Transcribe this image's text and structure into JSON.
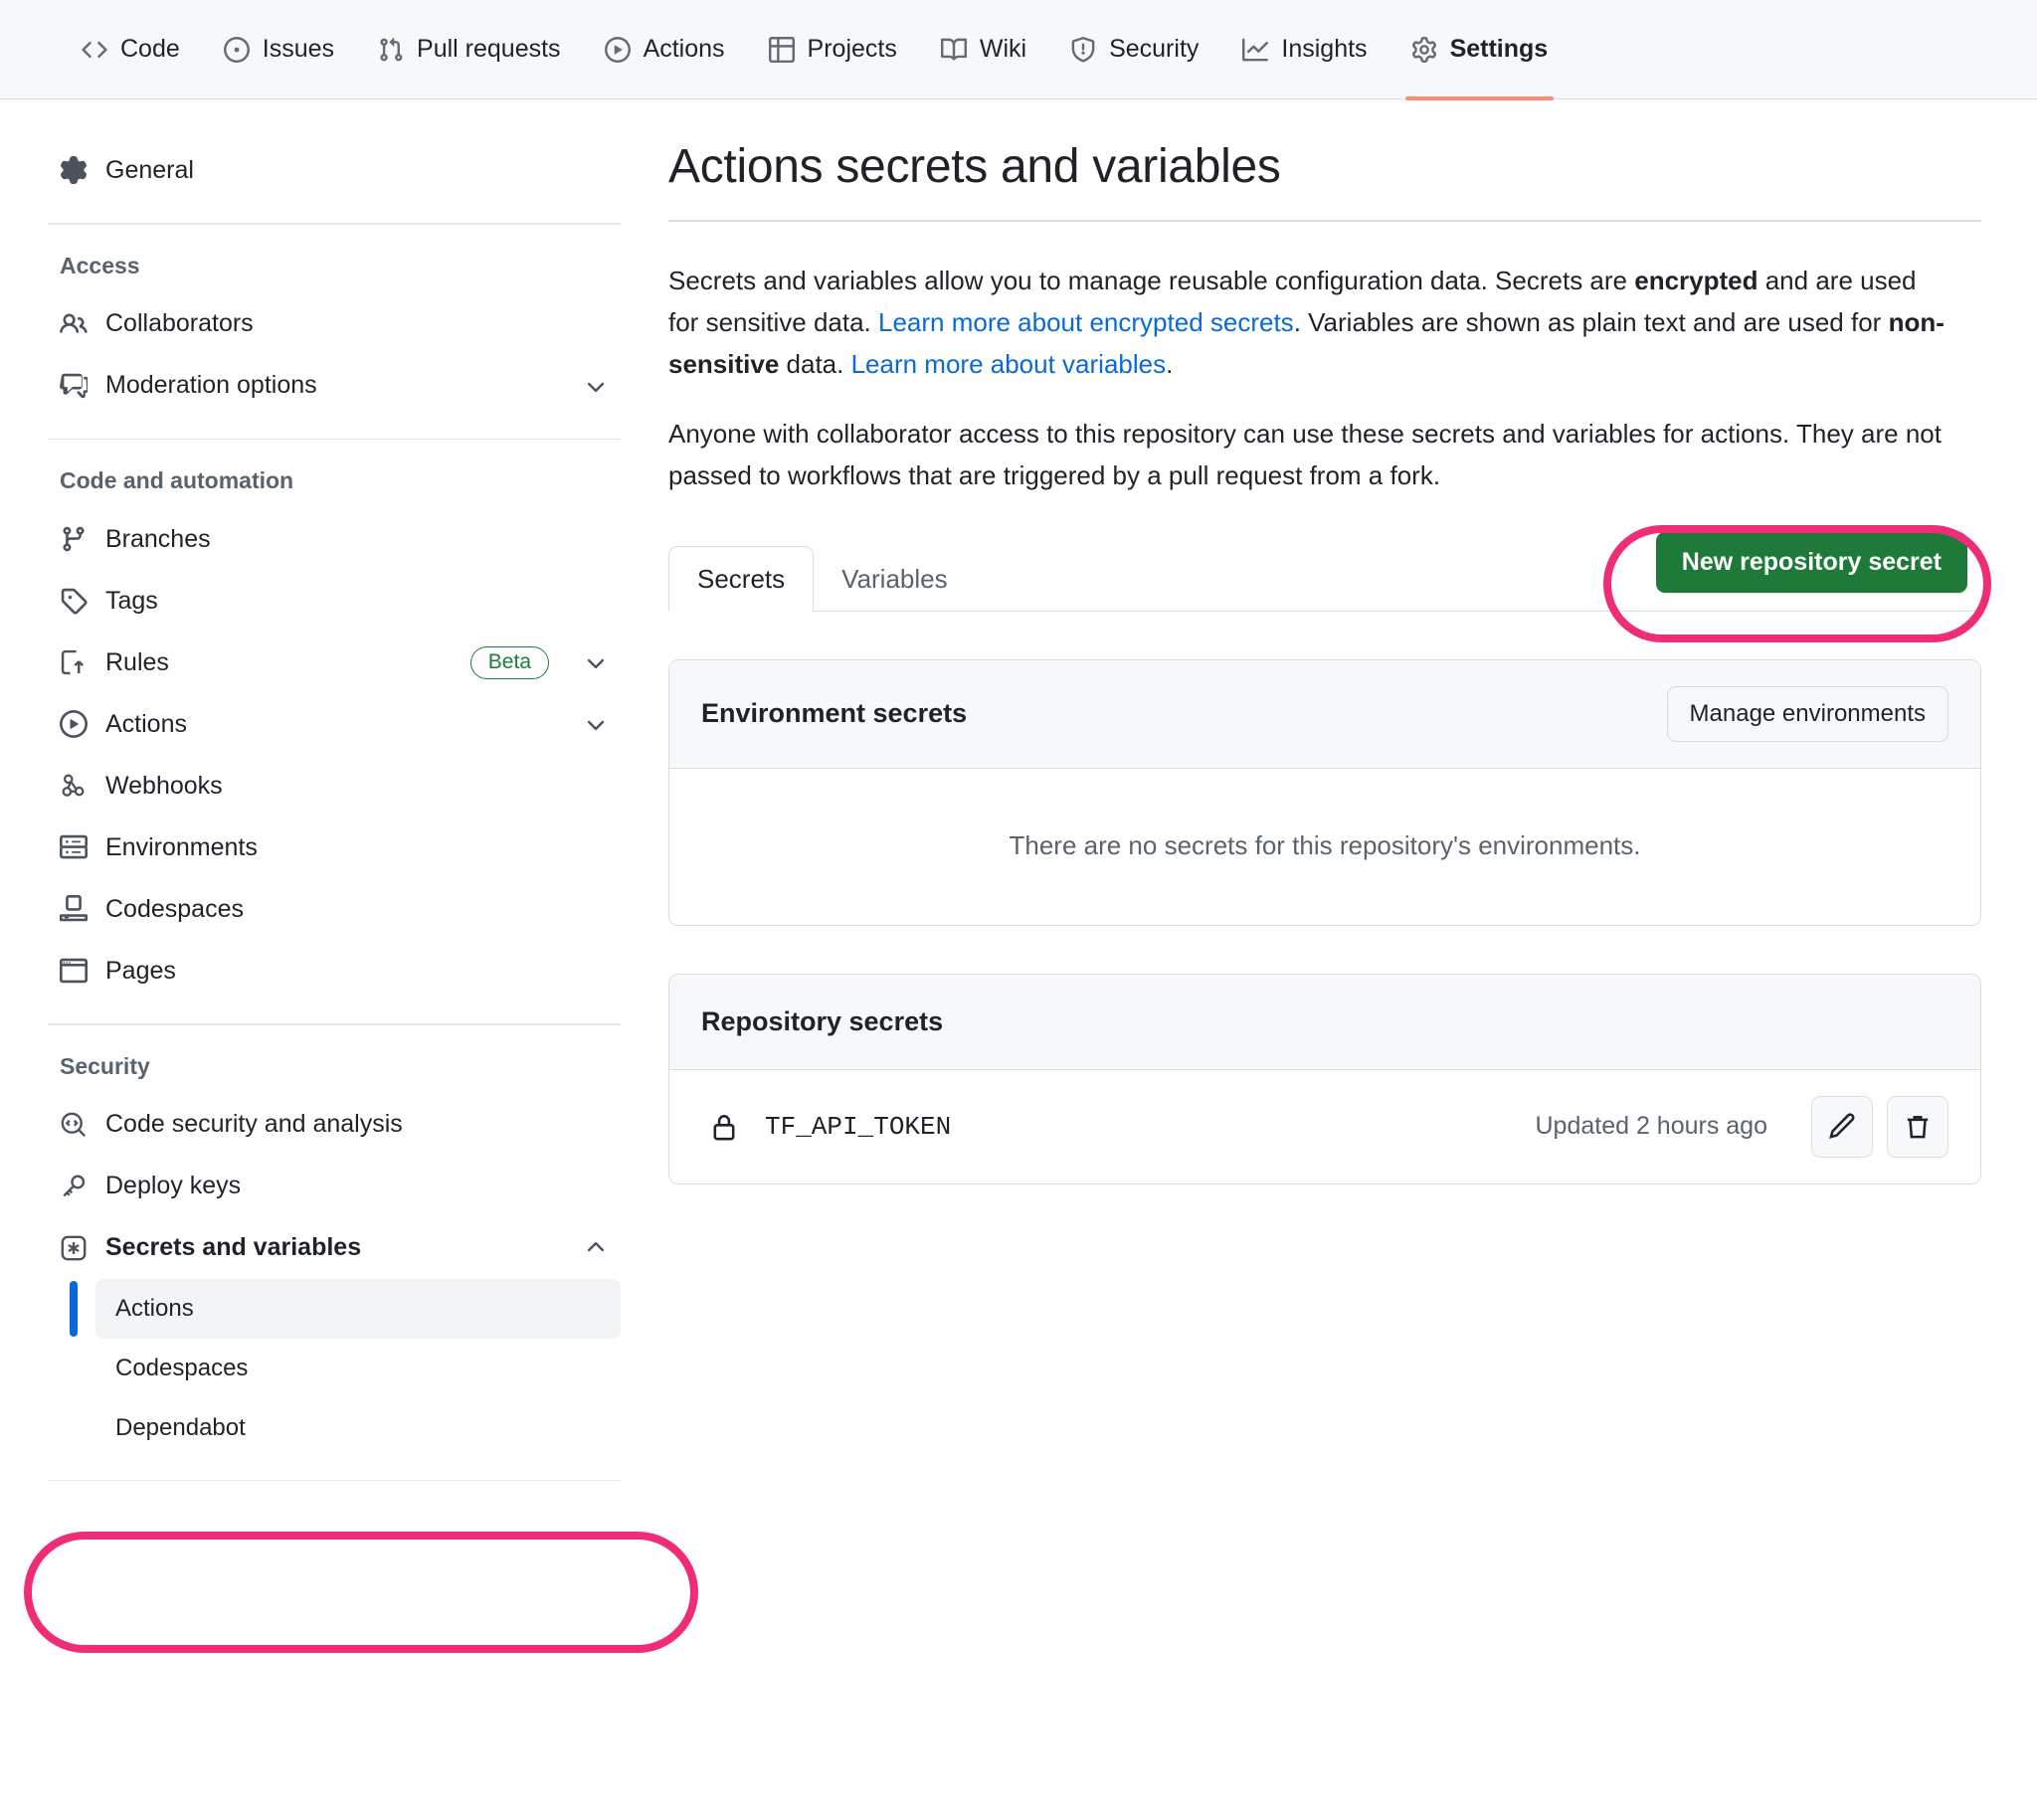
{
  "repo_nav": {
    "items": [
      {
        "label": "Code",
        "icon": "code-icon",
        "active": false
      },
      {
        "label": "Issues",
        "icon": "issue-opened-icon",
        "active": false
      },
      {
        "label": "Pull requests",
        "icon": "git-pull-request-icon",
        "active": false
      },
      {
        "label": "Actions",
        "icon": "play-icon",
        "active": false
      },
      {
        "label": "Projects",
        "icon": "table-icon",
        "active": false
      },
      {
        "label": "Wiki",
        "icon": "book-icon",
        "active": false
      },
      {
        "label": "Security",
        "icon": "shield-icon",
        "active": false
      },
      {
        "label": "Insights",
        "icon": "graph-icon",
        "active": false
      },
      {
        "label": "Settings",
        "icon": "gear-icon",
        "active": true
      }
    ],
    "active_underline_color": "#fd8c73"
  },
  "sidebar": {
    "general": {
      "label": "General",
      "icon": "gear-icon"
    },
    "sections": [
      {
        "heading": "Access",
        "items": [
          {
            "label": "Collaborators",
            "icon": "people-icon",
            "chevron": false
          },
          {
            "label": "Moderation options",
            "icon": "comment-icon",
            "chevron": true
          }
        ]
      },
      {
        "heading": "Code and automation",
        "items": [
          {
            "label": "Branches",
            "icon": "git-branch-icon",
            "chevron": false
          },
          {
            "label": "Tags",
            "icon": "tag-icon",
            "chevron": false
          },
          {
            "label": "Rules",
            "icon": "rules-icon",
            "chevron": true,
            "badge": "Beta"
          },
          {
            "label": "Actions",
            "icon": "play-icon",
            "chevron": true
          },
          {
            "label": "Webhooks",
            "icon": "webhook-icon",
            "chevron": false
          },
          {
            "label": "Environments",
            "icon": "server-icon",
            "chevron": false
          },
          {
            "label": "Codespaces",
            "icon": "codespaces-icon",
            "chevron": false
          },
          {
            "label": "Pages",
            "icon": "browser-icon",
            "chevron": false
          }
        ]
      },
      {
        "heading": "Security",
        "items": [
          {
            "label": "Code security and analysis",
            "icon": "codescan-icon",
            "chevron": false
          },
          {
            "label": "Deploy keys",
            "icon": "key-icon",
            "chevron": false
          },
          {
            "label": "Secrets and variables",
            "icon": "asterisk-icon",
            "chevron": true,
            "expanded": true,
            "bold": true
          }
        ]
      }
    ],
    "secrets_children": [
      {
        "label": "Actions",
        "selected": true
      },
      {
        "label": "Codespaces",
        "selected": false
      },
      {
        "label": "Dependabot",
        "selected": false
      }
    ],
    "badge_color": "#1a7f37",
    "selected_marker_color": "#0969da"
  },
  "main": {
    "title": "Actions secrets and variables",
    "paragraph1": {
      "part1": "Secrets and variables allow you to manage reusable configuration data. Secrets are ",
      "bold1": "encrypted",
      "part2": " and are used for sensitive data. ",
      "link1": "Learn more about encrypted secrets",
      "part3": ". Variables are shown as plain text and are used for ",
      "bold2": "non-sensitive",
      "part4": " data. ",
      "link2": "Learn more about variables",
      "part5": "."
    },
    "paragraph2": "Anyone with collaborator access to this repository can use these secrets and variables for actions. They are not passed to workflows that are triggered by a pull request from a fork.",
    "tabs": [
      {
        "label": "Secrets",
        "active": true
      },
      {
        "label": "Variables",
        "active": false
      }
    ],
    "new_secret_button": "New repository secret",
    "environment_secrets": {
      "title": "Environment secrets",
      "manage_button": "Manage environments",
      "empty_text": "There are no secrets for this repository's environments."
    },
    "repository_secrets": {
      "title": "Repository secrets",
      "rows": [
        {
          "name": "TF_API_TOKEN",
          "updated": "Updated 2 hours ago",
          "lock_icon": "lock-icon",
          "edit_icon": "pencil-icon",
          "delete_icon": "trash-icon"
        }
      ]
    },
    "accent_green": "#1f7a3a",
    "link_color": "#0969da"
  },
  "annotations": {
    "color": "#ef2d77",
    "highlights": [
      {
        "target": "new-repository-secret-button"
      },
      {
        "target": "sidebar-secrets-actions-item"
      }
    ]
  }
}
